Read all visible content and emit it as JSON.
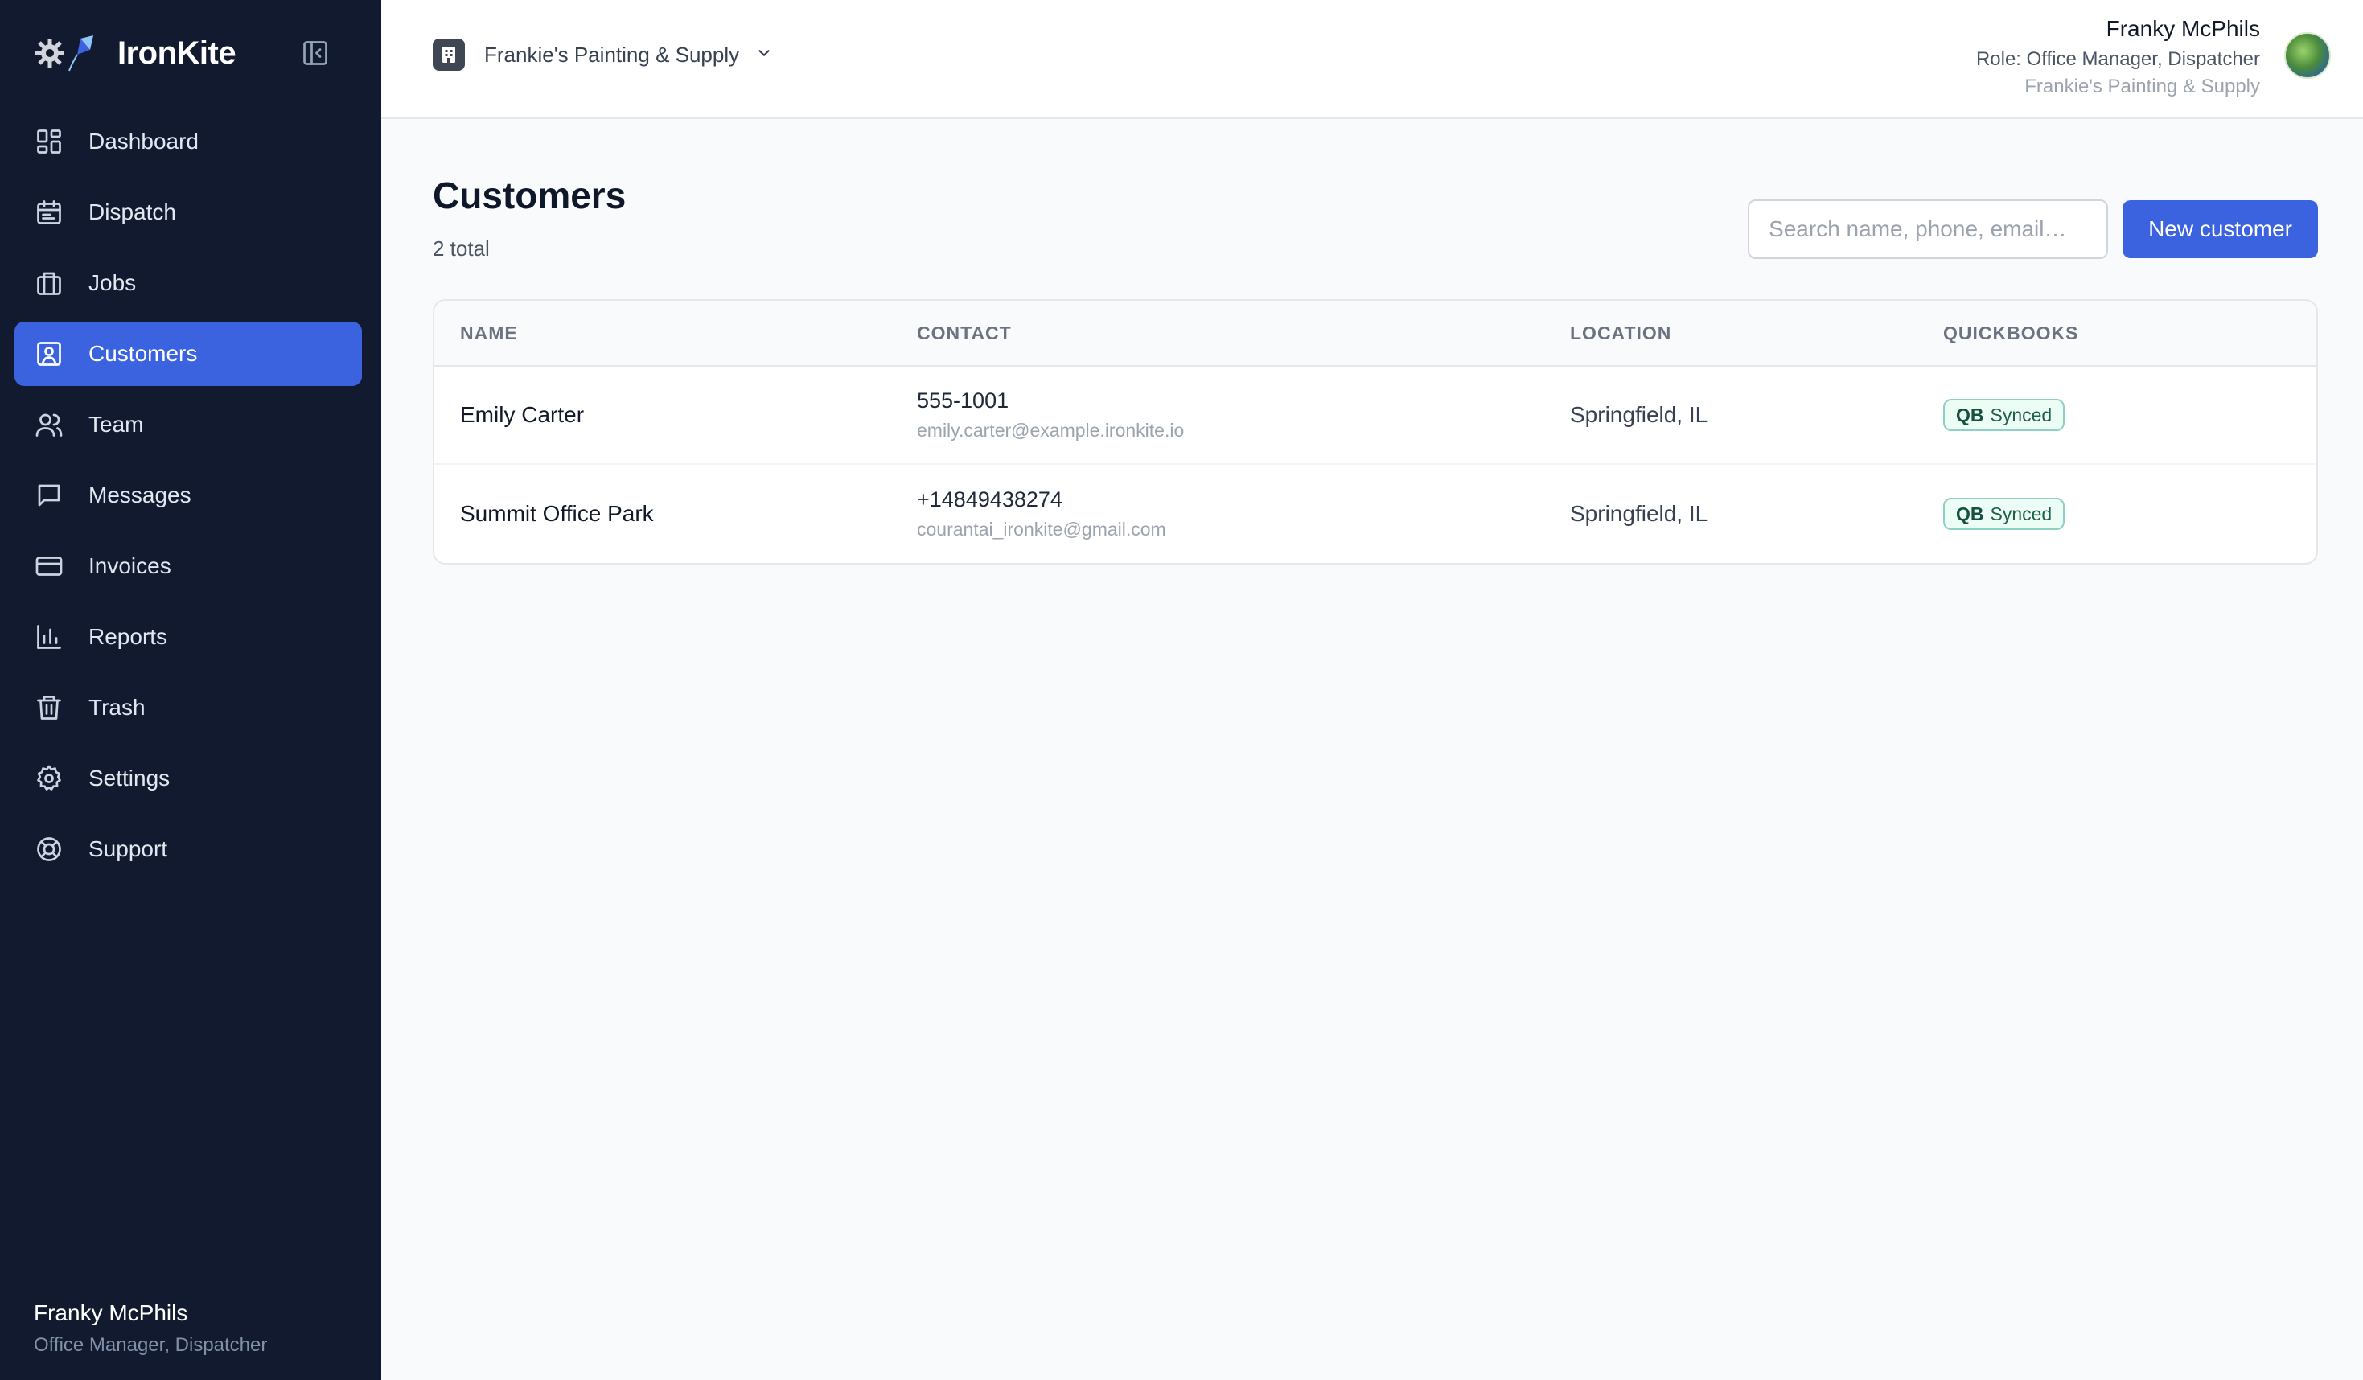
{
  "app": {
    "name": "IronKite"
  },
  "sidebar": {
    "items": [
      {
        "label": "Dashboard",
        "icon": "dashboard-icon",
        "active": false
      },
      {
        "label": "Dispatch",
        "icon": "calendar-icon",
        "active": false
      },
      {
        "label": "Jobs",
        "icon": "briefcase-icon",
        "active": false
      },
      {
        "label": "Customers",
        "icon": "contact-icon",
        "active": true
      },
      {
        "label": "Team",
        "icon": "users-icon",
        "active": false
      },
      {
        "label": "Messages",
        "icon": "message-icon",
        "active": false
      },
      {
        "label": "Invoices",
        "icon": "credit-card-icon",
        "active": false
      },
      {
        "label": "Reports",
        "icon": "bar-chart-icon",
        "active": false
      },
      {
        "label": "Trash",
        "icon": "trash-icon",
        "active": false
      },
      {
        "label": "Settings",
        "icon": "gear-icon",
        "active": false
      },
      {
        "label": "Support",
        "icon": "lifebuoy-icon",
        "active": false
      }
    ],
    "footer": {
      "name": "Franky McPhils",
      "role": "Office Manager, Dispatcher"
    }
  },
  "topbar": {
    "org_name": "Frankie's Painting & Supply",
    "user": {
      "name": "Franky McPhils",
      "role": "Role: Office Manager, Dispatcher",
      "org": "Frankie's Painting & Supply"
    }
  },
  "page": {
    "title": "Customers",
    "count": "2 total",
    "search_placeholder": "Search name, phone, email…",
    "new_button": "New customer"
  },
  "table": {
    "headers": {
      "name": "NAME",
      "contact": "CONTACT",
      "location": "LOCATION",
      "quickbooks": "QUICKBOOKS"
    },
    "rows": [
      {
        "name": "Emily Carter",
        "phone": "555-1001",
        "email": "emily.carter@example.ironkite.io",
        "location": "Springfield, IL",
        "qb_mark": "QB",
        "qb_status": "Synced"
      },
      {
        "name": "Summit Office Park",
        "phone": "+14849438274",
        "email": "courantai_ironkite@gmail.com",
        "location": "Springfield, IL",
        "qb_mark": "QB",
        "qb_status": "Synced"
      }
    ]
  },
  "colors": {
    "sidebar_bg": "#111a2e",
    "accent": "#3b63e0",
    "synced_badge_border": "#8fd0c4"
  }
}
